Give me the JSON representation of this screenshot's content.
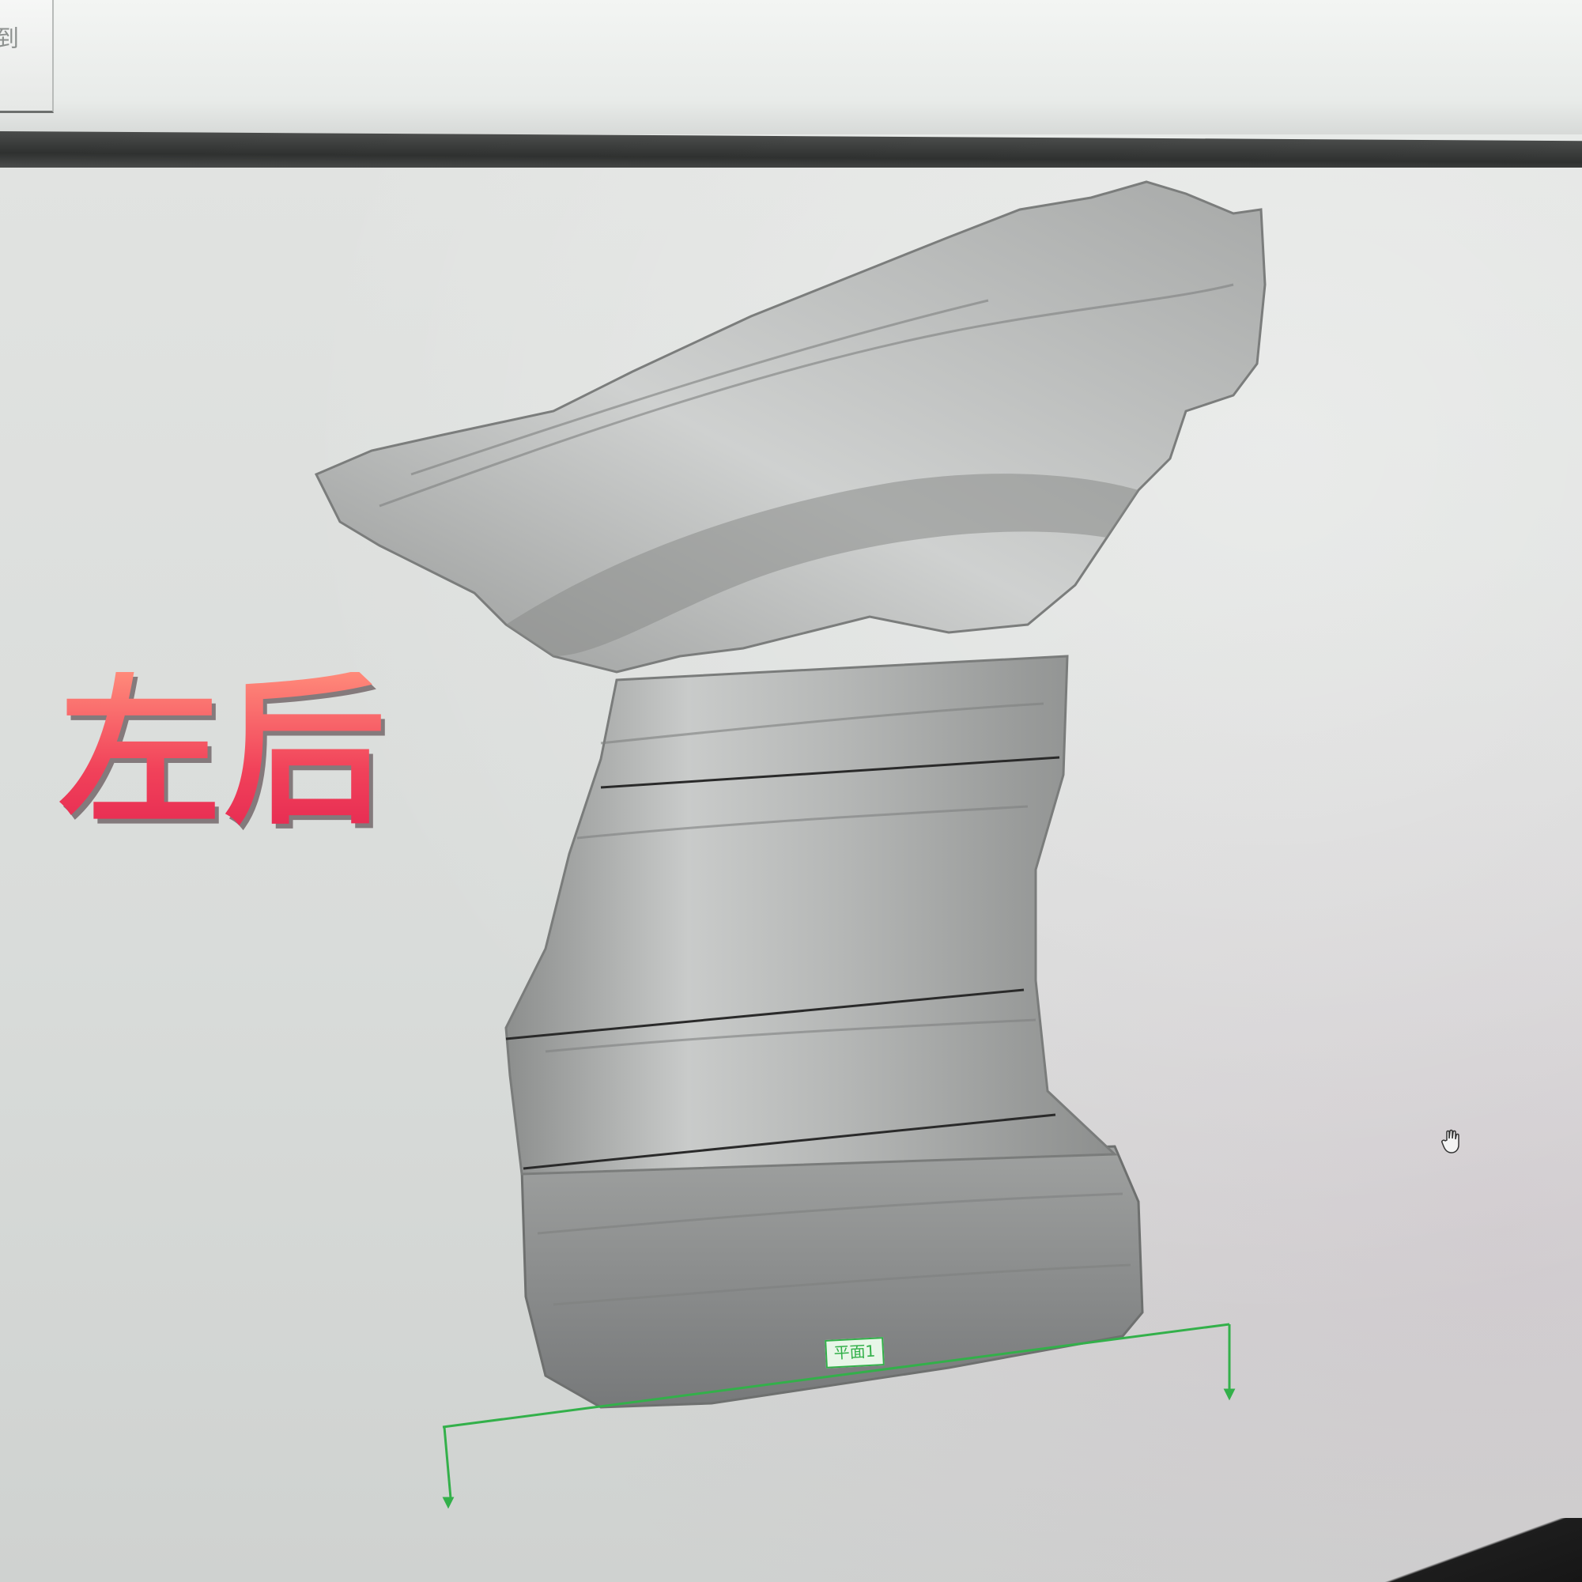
{
  "toolbar": {
    "partial_label": "到"
  },
  "overlay": {
    "label": "左后",
    "color": "#f24a5f"
  },
  "viewport": {
    "plane_tag": "平面1",
    "plane_color": "#33b04a",
    "model_color": "#a9abaa",
    "section_line_color": "#2a2a2a"
  },
  "icons": [
    "hand-cursor-icon"
  ]
}
